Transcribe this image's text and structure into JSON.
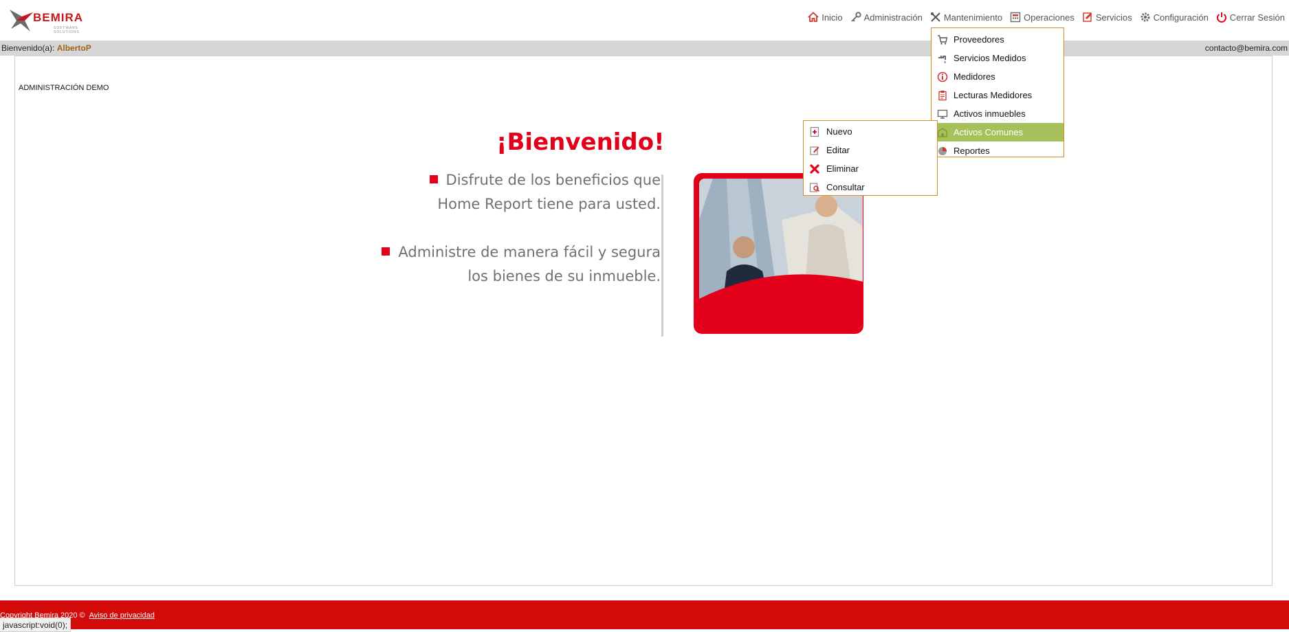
{
  "brand": {
    "name": "BEMIRA",
    "tagline": "SOFTWARE SOLUTIONS",
    "accent": "#e2001a"
  },
  "topnav": [
    {
      "label": "Inicio",
      "icon": "home-icon"
    },
    {
      "label": "Administración",
      "icon": "key-icon"
    },
    {
      "label": "Mantenimiento",
      "icon": "tools-icon"
    },
    {
      "label": "Operaciones",
      "icon": "calculator-icon"
    },
    {
      "label": "Servicios",
      "icon": "services-icon"
    },
    {
      "label": "Configuración",
      "icon": "gear-icon"
    },
    {
      "label": "Cerrar Sesión",
      "icon": "power-icon"
    }
  ],
  "welcome": {
    "prefix": "Bienvenido(a): ",
    "user": "AlbertoP",
    "email": "contacto@bemira.com"
  },
  "main": {
    "demo_label": "ADMINISTRACIÓN DEMO",
    "hero_title": "¡Bienvenido!",
    "hero_lines": [
      "Disfrute de los beneficios que",
      "Home Report tiene para usted.",
      "Administre de manera fácil y segura",
      "los bienes de su inmueble."
    ]
  },
  "dropdown": {
    "items": [
      {
        "label": "Proveedores",
        "icon": "cart-icon"
      },
      {
        "label": "Servicios Medidos",
        "icon": "faucet-icon"
      },
      {
        "label": "Medidores",
        "icon": "info-icon"
      },
      {
        "label": "Lecturas Medidores",
        "icon": "clipboard-icon"
      },
      {
        "label": "Activos inmuebles",
        "icon": "monitor-icon"
      },
      {
        "label": "Activos Comunes",
        "icon": "building-icon"
      },
      {
        "label": "Reportes",
        "icon": "pie-chart-icon"
      }
    ],
    "active": "Activos Comunes"
  },
  "submenu": {
    "items": [
      {
        "label": "Nuevo",
        "icon": "new-icon"
      },
      {
        "label": "Editar",
        "icon": "edit-icon"
      },
      {
        "label": "Eliminar",
        "icon": "delete-icon"
      },
      {
        "label": "Consultar",
        "icon": "search-icon"
      }
    ]
  },
  "footer": {
    "text": "Copyright Bemira 2020 ©",
    "privacy_link": "Aviso de privacidad"
  },
  "status_bar": {
    "url": "javascript:void(0);"
  }
}
